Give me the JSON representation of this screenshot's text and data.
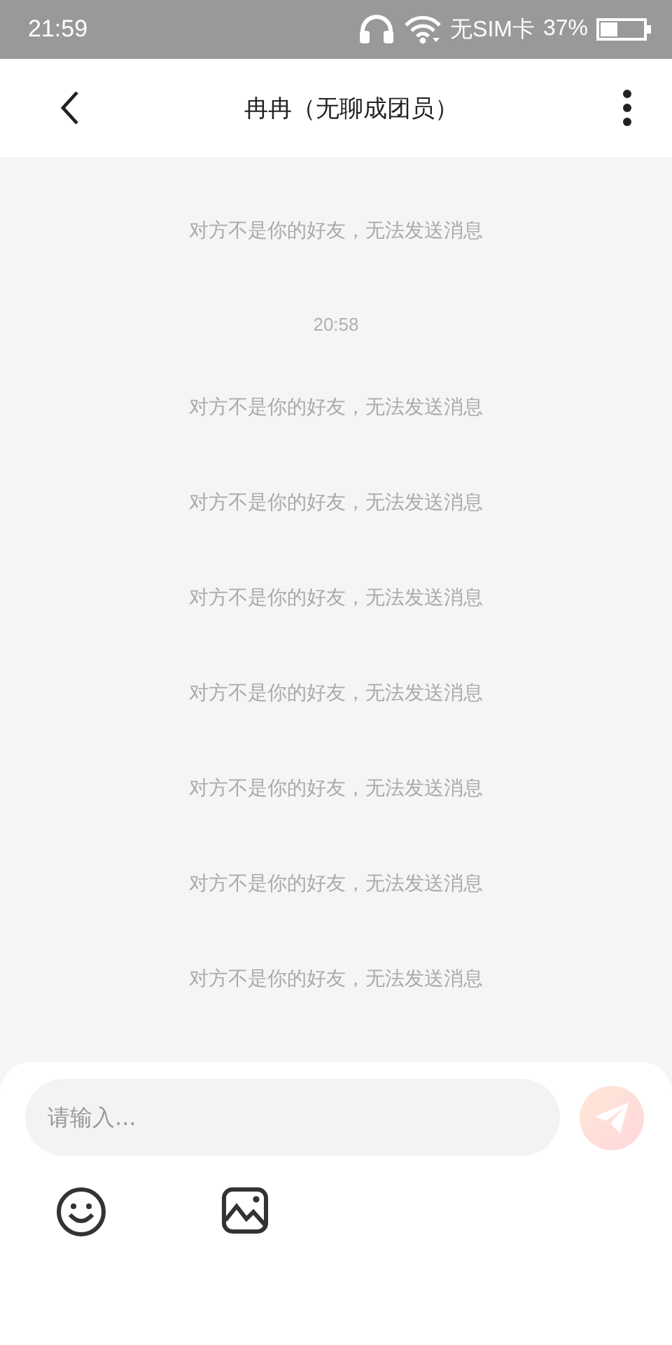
{
  "status_bar": {
    "time": "21:59",
    "carrier": "无SIM卡",
    "battery": "37%"
  },
  "header": {
    "title": "冉冉（无聊成团员）"
  },
  "messages": [
    {
      "kind": "notice",
      "text": "对方不是你的好友，无法发送消息"
    },
    {
      "kind": "time",
      "text": "20:58"
    },
    {
      "kind": "notice",
      "text": "对方不是你的好友，无法发送消息"
    },
    {
      "kind": "notice",
      "text": "对方不是你的好友，无法发送消息"
    },
    {
      "kind": "notice",
      "text": "对方不是你的好友，无法发送消息"
    },
    {
      "kind": "notice",
      "text": "对方不是你的好友，无法发送消息"
    },
    {
      "kind": "notice",
      "text": "对方不是你的好友，无法发送消息"
    },
    {
      "kind": "notice",
      "text": "对方不是你的好友，无法发送消息"
    },
    {
      "kind": "notice",
      "text": "对方不是你的好友，无法发送消息"
    }
  ],
  "composer": {
    "placeholder": "请输入..."
  }
}
